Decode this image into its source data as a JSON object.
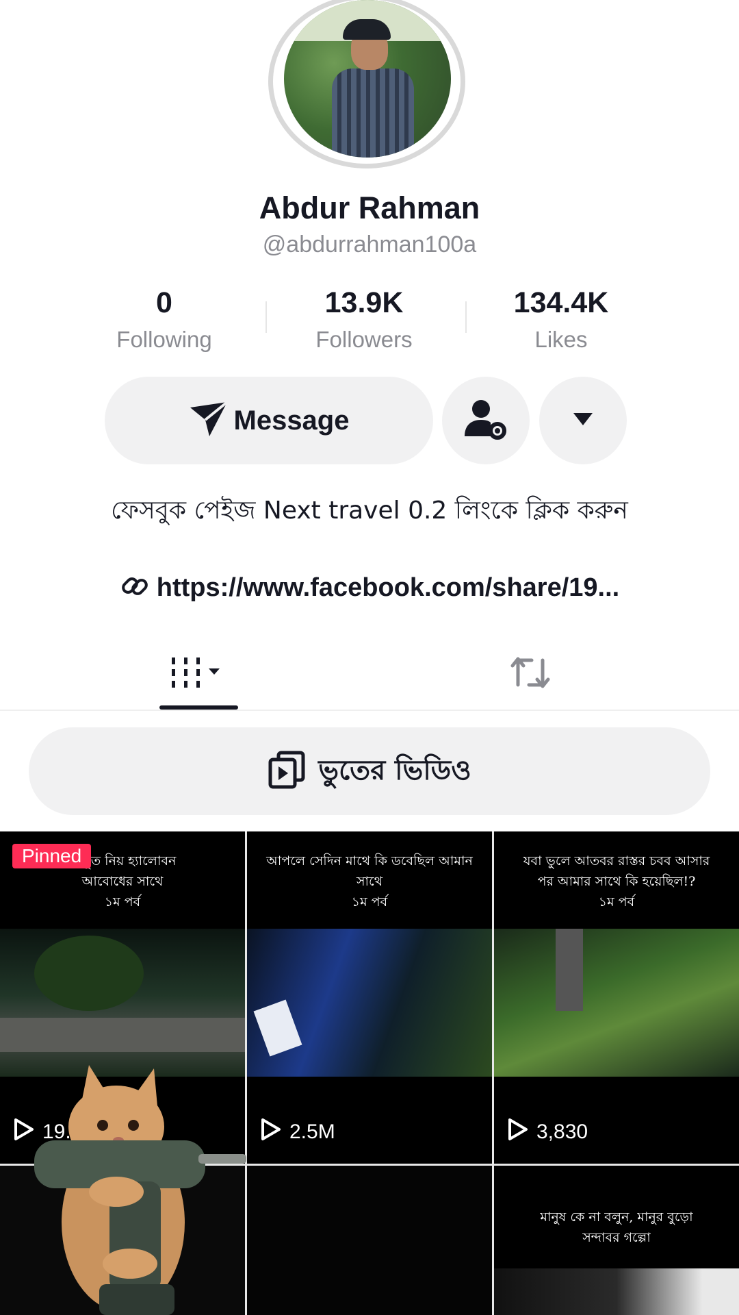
{
  "profile": {
    "display_name": "Abdur Rahman",
    "handle": "@abdurrahman100a"
  },
  "stats": {
    "following": {
      "value": "0",
      "label": "Following"
    },
    "followers": {
      "value": "13.9K",
      "label": "Followers"
    },
    "likes": {
      "value": "134.4K",
      "label": "Likes"
    }
  },
  "actions": {
    "message_label": "Message"
  },
  "bio": {
    "text": "ফেসবুক পেইজ Next travel 0.2 লিংকে ক্লিক করুন",
    "link": "https://www.facebook.com/share/19..."
  },
  "playlist": {
    "label": "ভুতের ভিডিও"
  },
  "videos": [
    {
      "caption_line1": "...ভূত নিয় হ্যালোবন",
      "caption_line2": "আবোধের সাথে",
      "caption_line3": "১ম পর্ব",
      "views": "19...",
      "badge": "Pinned"
    },
    {
      "caption_line1": "আপলে সেদিন মাথে কি ডবেছিল আমান",
      "caption_line2": "সাথে",
      "caption_line3": "১ম পর্ব",
      "views": "2.5M"
    },
    {
      "caption_line1": "যবা ভুলে আতবর রাস্তর চবব আসার",
      "caption_line2": "পর আমার সাথে কি হয়েছিল!?",
      "caption_line3": "১ম পর্ব",
      "views": "3,830"
    },
    {
      "caption_line1": "মানুষ কে না বলুন, মানুর বুড়ো",
      "caption_line2": "সন্দাবর গল্পো"
    }
  ],
  "colors": {
    "accent_pinned": "#fe2c55",
    "button_bg": "#f1f1f2",
    "text_primary": "#161823",
    "text_secondary": "#8a8b91"
  },
  "icons": {
    "message": "paper-plane-icon",
    "follow_settings": "user-gear-icon",
    "more": "caret-down-icon",
    "link": "link-icon",
    "videos_tab": "grid-icon",
    "reposts_tab": "repost-icon",
    "playlist": "playlist-icon",
    "play": "play-icon"
  }
}
